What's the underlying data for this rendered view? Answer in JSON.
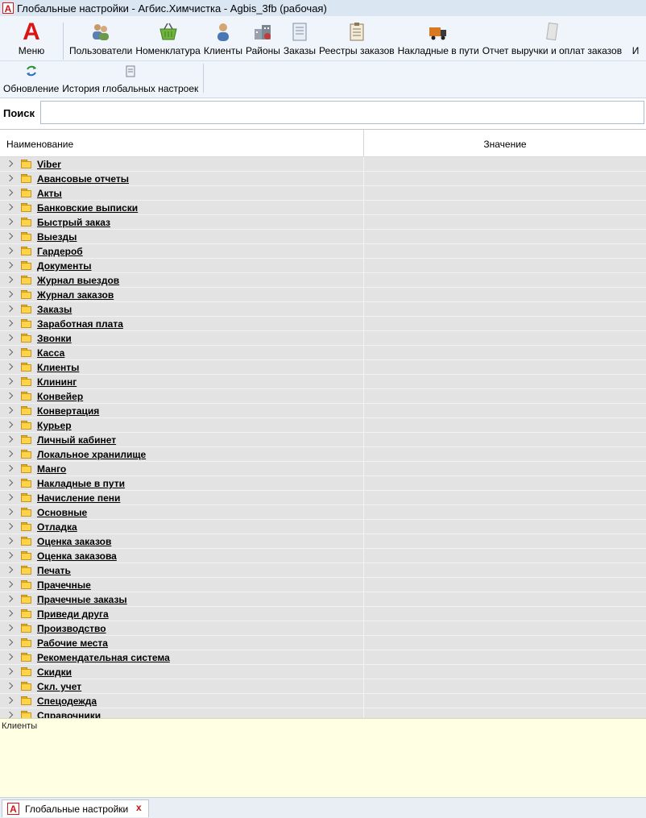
{
  "window": {
    "title": "Глобальные настройки - Агбис.Химчистка - Agbis_3fb (рабочая)"
  },
  "ribbon": {
    "menu_label": "Меню",
    "row1": [
      {
        "label": "Пользователи",
        "icon": "users-icon"
      },
      {
        "label": "Номенклатура",
        "icon": "basket-icon"
      },
      {
        "label": "Клиенты",
        "icon": "client-icon"
      },
      {
        "label": "Районы",
        "icon": "district-icon"
      },
      {
        "label": "Заказы",
        "icon": "order-icon"
      },
      {
        "label": "Реестры заказов",
        "icon": "registry-icon"
      },
      {
        "label": "Накладные в пути",
        "icon": "truck-icon"
      },
      {
        "label": "Отчет выручки и оплат заказов",
        "icon": "report-icon"
      },
      {
        "label": "И",
        "icon": ""
      }
    ],
    "row2": [
      {
        "label": "Обновление",
        "icon": "refresh-icon"
      },
      {
        "label": "История глобальных настроек",
        "icon": "history-icon"
      }
    ]
  },
  "search": {
    "label": "Поиск",
    "value": "",
    "placeholder": ""
  },
  "grid": {
    "col_name": "Наименование",
    "col_value": "Значение",
    "rows": [
      "Viber",
      "Авансовые отчеты",
      "Акты",
      "Банковские выписки",
      "Быстрый заказ",
      "Выезды",
      "Гардероб",
      "Документы",
      "Журнал выездов",
      "Журнал заказов",
      "Заказы",
      "Заработная плата",
      "Звонки",
      "Касса",
      "Клиенты",
      "Клининг",
      "Конвейер",
      "Конвертация",
      "Курьер",
      "Личный кабинет",
      "Локальное хранилище",
      "Манго",
      "Накладные в пути",
      "Начисление пени",
      "Основные",
      "Отладка",
      "Оценка заказов",
      "Оценка заказова",
      "Печать",
      "Прачечные",
      "Прачечные заказы",
      "Приведи друга",
      "Производство",
      "Рабочие места",
      "Рекомендательная система",
      "Скидки",
      "Скл. учет",
      "Спецодежда",
      "Справочники"
    ]
  },
  "description": {
    "text": "Клиенты"
  },
  "tabs": [
    {
      "label": "Глобальные настройки",
      "close": "x"
    }
  ],
  "colors": {
    "accent": "#d91515",
    "folder": "#ffd34a",
    "row_bg": "#e3e3e3",
    "desc_bg": "#ffffe4"
  }
}
